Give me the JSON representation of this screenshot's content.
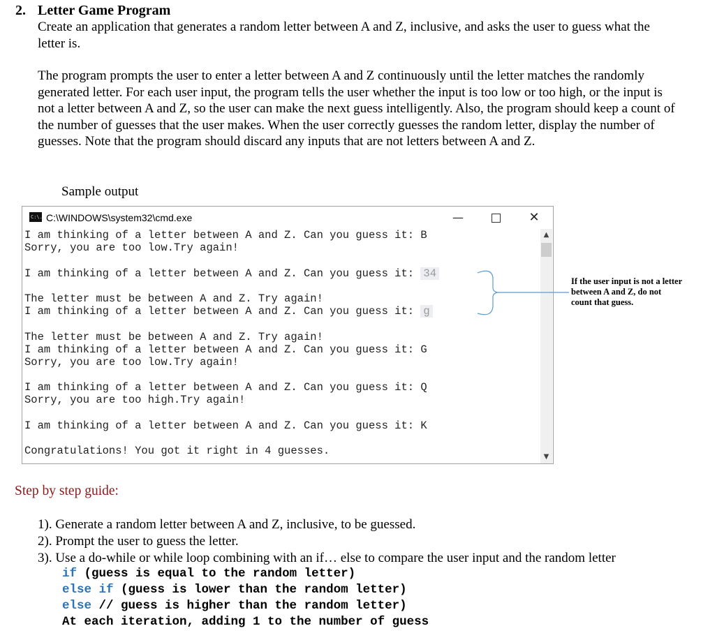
{
  "heading": {
    "number": "2.",
    "title": "Letter Game Program"
  },
  "intro": "Create an application that generates a random letter between A and Z, inclusive, and asks the user to guess what the letter is.",
  "body": "The program prompts the user to enter a letter between A and Z continuously until the letter matches the randomly generated letter. For each user input, the program tells the user whether the input is too low or too high, or the input is not a letter between A and Z, so the user can make the next guess intelligently. Also, the program should keep a count of the number of guesses that the user makes. When the user correctly guesses the random letter, display the number of guesses. Note that the program should discard any inputs that are not letters between A and Z.",
  "sample_label": "Sample output",
  "console": {
    "title": "C:\\WINDOWS\\system32\\cmd.exe",
    "icon": "cmd-icon",
    "icon_text": "C:\\.",
    "controls": {
      "minimize": "—",
      "close": "✕"
    },
    "scroll_up": "▲",
    "scroll_down": "▼",
    "lines": [
      {
        "text": "I am thinking of a letter between A and Z. Can you guess it: ",
        "input": "B"
      },
      {
        "text": "Sorry, you are too low.Try again!"
      },
      {
        "text": ""
      },
      {
        "text": "I am thinking of a letter between A and Z. Can you guess it: ",
        "input": "34",
        "highlight": true
      },
      {
        "text": ""
      },
      {
        "text": "The letter must be between A and Z. Try again!"
      },
      {
        "text": "I am thinking of a letter between A and Z. Can you guess it: ",
        "input": "g",
        "highlight": true
      },
      {
        "text": ""
      },
      {
        "text": "The letter must be between A and Z. Try again!"
      },
      {
        "text": "I am thinking of a letter between A and Z. Can you guess it: ",
        "input": "G"
      },
      {
        "text": "Sorry, you are too low.Try again!"
      },
      {
        "text": ""
      },
      {
        "text": "I am thinking of a letter between A and Z. Can you guess it: ",
        "input": "Q"
      },
      {
        "text": "Sorry, you are too high.Try again!"
      },
      {
        "text": ""
      },
      {
        "text": "I am thinking of a letter between A and Z. Can you guess it: ",
        "input": "K"
      },
      {
        "text": ""
      },
      {
        "text": "Congratulations! You got it right in 4 guesses."
      }
    ]
  },
  "annotation": "If the user input is not a letter between A and Z, do not count that guess.",
  "step_heading": "Step by step guide:",
  "steps": [
    "1). Generate a random letter between A and Z, inclusive, to be guessed.",
    "2). Prompt the user to guess the letter.",
    "3). Use a do-while or while loop combining with an if… else to compare the user input and the random letter"
  ],
  "code": {
    "line1_kw": "if",
    "line1_rest": " (guess is equal to the random letter)",
    "line2_kw": "else if",
    "line2_rest": " (guess is lower than the random letter)",
    "line3_kw": "else",
    "line3_rest": " // guess is higher than the random letter)",
    "line4": "At each iteration, adding 1 to the number of guess"
  },
  "colors": {
    "keyword": "#2e74b5",
    "step_heading": "#8b1a1a",
    "annotation_line": "#5b9bd5"
  }
}
